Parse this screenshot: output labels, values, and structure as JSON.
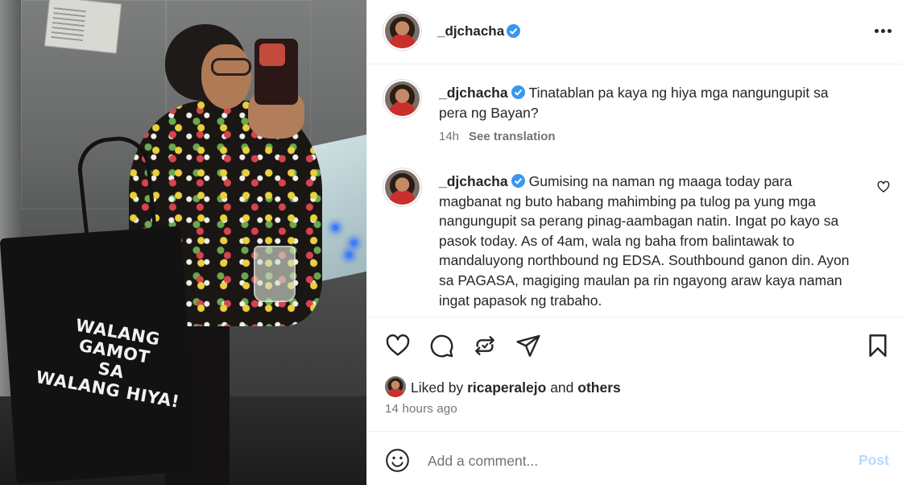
{
  "photo": {
    "bag_text_lines": [
      "WALANG GAMOT",
      "SA",
      "WALANG HIYA!"
    ]
  },
  "header": {
    "username": "_djchacha",
    "more_icon": "more-horizontal-icon"
  },
  "comments": [
    {
      "username": "_djchacha",
      "text": "Tinatablan pa kaya ng hiya mga nangungupit sa pera ng Bayan?",
      "time": "14h",
      "translate_label": "See translation"
    },
    {
      "username": "_djchacha",
      "text": "Gumising na naman ng maaga today para magbanat ng buto habang mahimbing pa tulog pa yung mga nangungupit sa perang pinag-aambagan natin. Ingat po kayo sa pasok today. As of 4am, wala ng baha from balintawak to mandaluyong northbound ng EDSA. Southbound ganon din. Ayon sa PAGASA, magiging maulan pa rin ngayong araw kaya naman ingat papasok ng trabaho."
    }
  ],
  "likes": {
    "prefix": "Liked by",
    "user": "ricaperalejo",
    "conjunction": "and",
    "others": "others"
  },
  "timestamp": "14 hours ago",
  "comment_box": {
    "placeholder": "Add a comment...",
    "post_label": "Post"
  },
  "colors": {
    "verified": "#3897f0",
    "post_disabled": "#b3dbff",
    "secondary_text": "#737373"
  }
}
